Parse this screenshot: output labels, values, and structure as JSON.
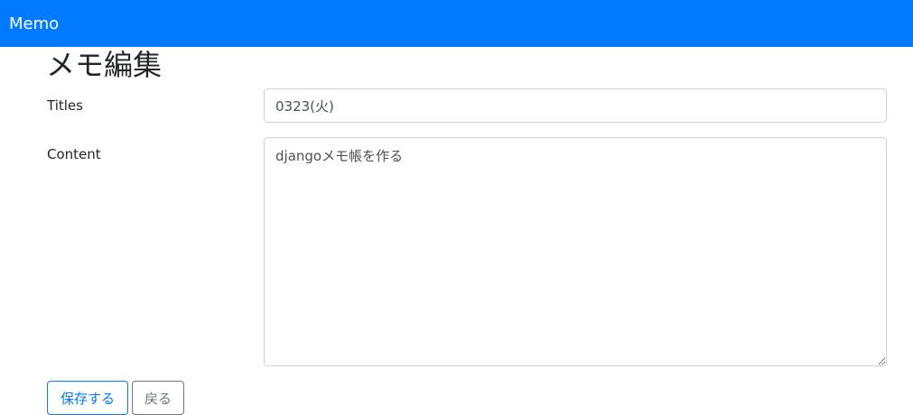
{
  "navbar": {
    "brand": "Memo",
    "color": "#007bff"
  },
  "page": {
    "title": "メモ編集"
  },
  "form": {
    "title_label": "Titles",
    "title_value": "0323(火)",
    "content_label": "Content",
    "content_value": "djangoメモ帳を作る"
  },
  "actions": {
    "save_label": "保存する",
    "save_color": "#007bff",
    "back_label": "戻る",
    "back_color": "#6c757d"
  }
}
